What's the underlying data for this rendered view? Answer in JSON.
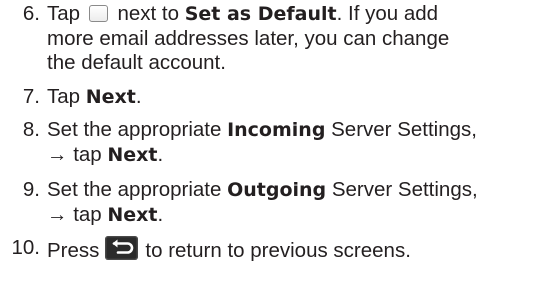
{
  "steps": [
    {
      "number": "6.",
      "lines": [
        {
          "parts": [
            "Tap",
            "next to",
            "Set as Default",
            ". If you add"
          ]
        },
        {
          "text": "more email addresses later, you can change"
        },
        {
          "text": "the default account."
        }
      ],
      "icon": "checkbox-icon"
    },
    {
      "number": "7.",
      "prefix": "Tap ",
      "bold": "Next",
      "suffix": "."
    },
    {
      "number": "8.",
      "prefix": "Set the appropriate ",
      "bold": "Incoming",
      "suffix": " Server Settings,",
      "line2_prefix": "→ tap ",
      "line2_bold": "Next",
      "line2_suffix": "."
    },
    {
      "number": "9.",
      "prefix": "Set the appropriate ",
      "bold": "Outgoing",
      "suffix": " Server Settings,",
      "line2_prefix": "→ tap ",
      "line2_bold": "Next",
      "line2_suffix": "."
    },
    {
      "number": "10.",
      "prefix": "Press",
      "suffix": "to return to previous screens.",
      "icon": "back-key-icon"
    }
  ],
  "colors": {
    "text": "#231f20",
    "back_key_bg": "#2b2b2b",
    "back_key_arrow": "#ffffff"
  }
}
